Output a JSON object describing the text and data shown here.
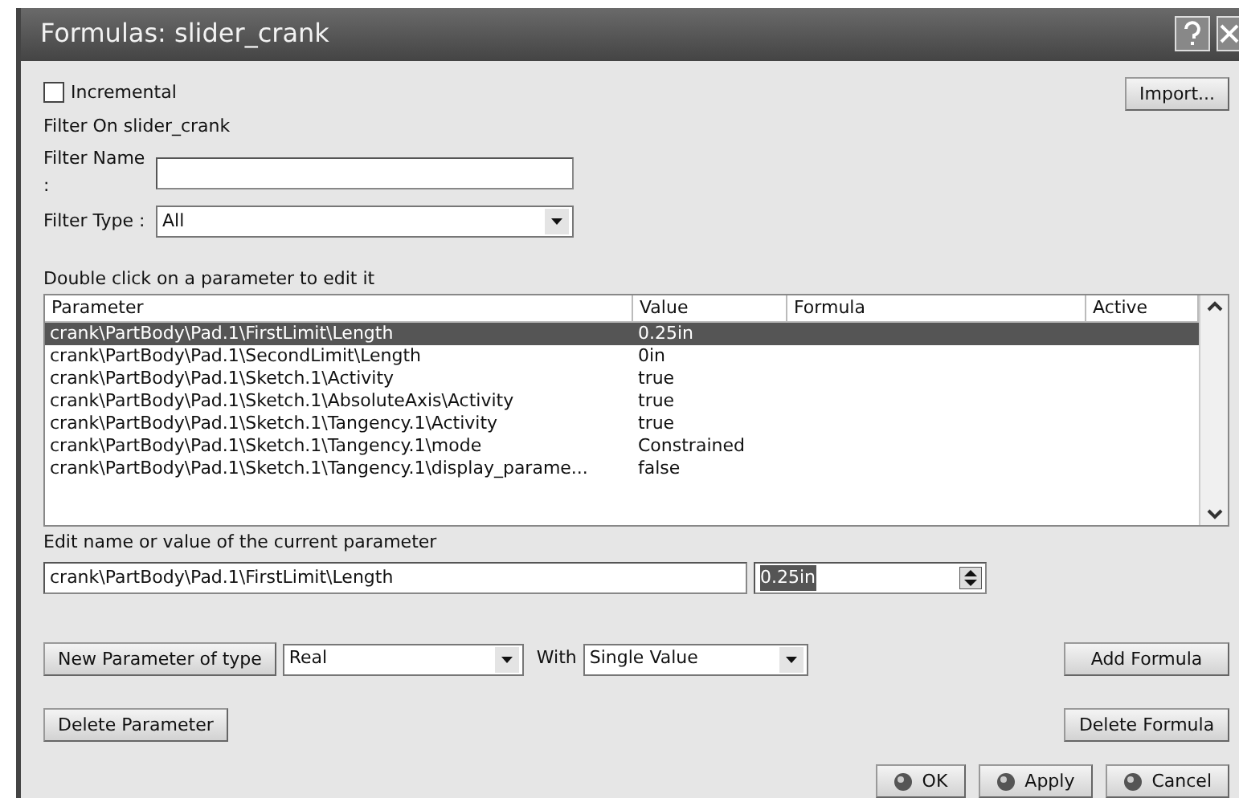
{
  "window": {
    "title": "Formulas: slider_crank"
  },
  "incremental": {
    "label": "Incremental",
    "checked": false
  },
  "import_button": "Import...",
  "filter_heading": "Filter On slider_crank",
  "filter_name": {
    "label": "Filter Name :"
  },
  "filter_type": {
    "label": "Filter Type :",
    "value": "All"
  },
  "table_hint": "Double click on a parameter to edit it",
  "table": {
    "columns": [
      "Parameter",
      "Value",
      "Formula",
      "Active"
    ],
    "rows": [
      {
        "parameter": "crank\\PartBody\\Pad.1\\FirstLimit\\Length",
        "value": "0.25in",
        "selected": true
      },
      {
        "parameter": "crank\\PartBody\\Pad.1\\SecondLimit\\Length",
        "value": "0in",
        "selected": false
      },
      {
        "parameter": "crank\\PartBody\\Pad.1\\Sketch.1\\Activity",
        "value": "true",
        "selected": false
      },
      {
        "parameter": "crank\\PartBody\\Pad.1\\Sketch.1\\AbsoluteAxis\\Activity",
        "value": "true",
        "selected": false
      },
      {
        "parameter": "crank\\PartBody\\Pad.1\\Sketch.1\\Tangency.1\\Activity",
        "value": "true",
        "selected": false
      },
      {
        "parameter": "crank\\PartBody\\Pad.1\\Sketch.1\\Tangency.1\\mode",
        "value": "Constrained",
        "selected": false
      },
      {
        "parameter": "crank\\PartBody\\Pad.1\\Sketch.1\\Tangency.1\\display_parame...",
        "value": "false",
        "selected": false
      }
    ]
  },
  "edit_hint": "Edit name or value of the current parameter",
  "edit_name": "crank\\PartBody\\Pad.1\\FirstLimit\\Length",
  "edit_value": "0.25in",
  "new_parameter_button": "New Parameter of type",
  "parameter_type": "Real",
  "with_label": "With",
  "with_value": "Single Value",
  "add_formula_button": "Add Formula",
  "delete_parameter_button": "Delete Parameter",
  "delete_formula_button": "Delete Formula",
  "dialog_buttons": [
    "OK",
    "Apply",
    "Cancel"
  ]
}
